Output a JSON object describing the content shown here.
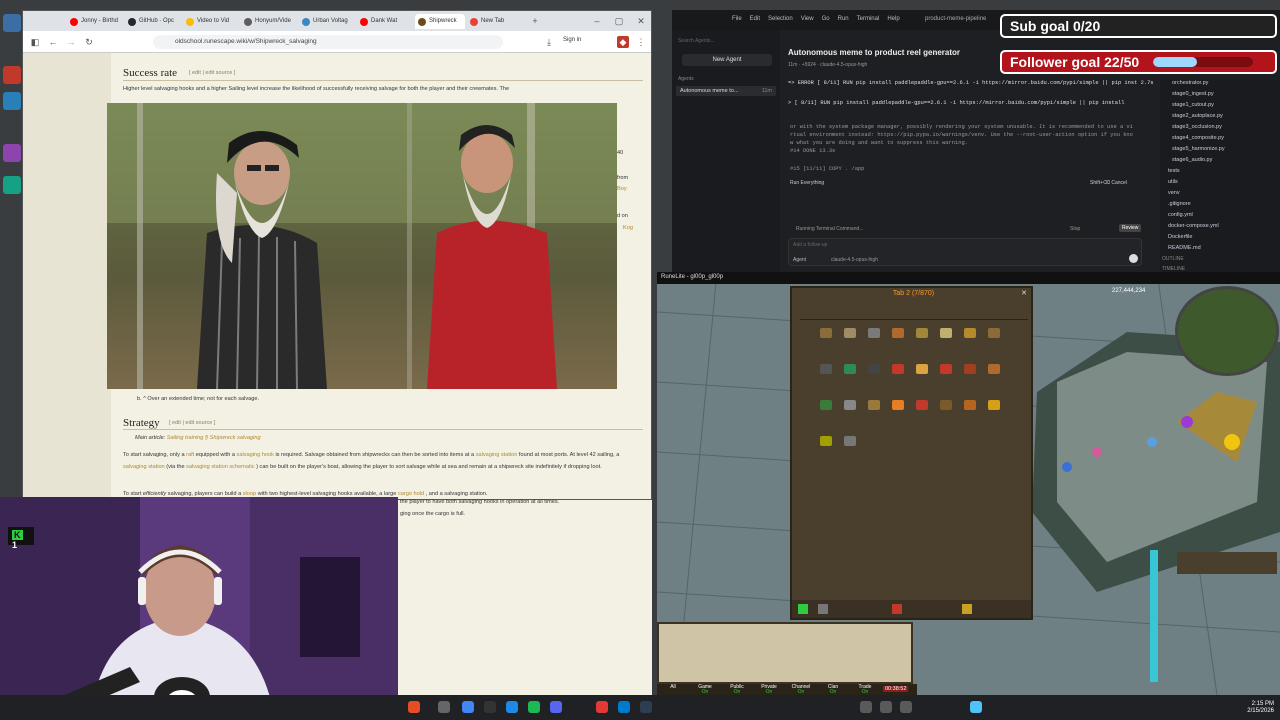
{
  "browser": {
    "tabs": [
      {
        "label": "Jonny - Birthd",
        "color": "#ff0000"
      },
      {
        "label": "GitHub · Opc",
        "color": "#24292e"
      },
      {
        "label": "Video to Vid",
        "color": "#fbbc04"
      },
      {
        "label": "Honyum/Vide",
        "color": "#5e5e5e"
      },
      {
        "label": "Urban Voltag",
        "color": "#3b88c3"
      },
      {
        "label": "Dank Wat",
        "color": "#ff0000"
      },
      {
        "label": "Shipwreck",
        "color": "#6b4c1e"
      },
      {
        "label": "New Tab",
        "color": "#e94235"
      }
    ],
    "url": "oldschool.runescape.wiki/w/Shipwreck_salvaging",
    "sign_in": "Sign in"
  },
  "wiki": {
    "section1_title": "Success rate",
    "section1_edit": "[ edit | edit source ]",
    "section1_text": "Higher level salvaging hooks and a higher Sailing level increase the likelihood of successfully receiving salvage for both the player and their crewmates. The",
    "side_numbers": [
      "40",
      "from",
      "Boy",
      "d on",
      "Kog"
    ],
    "footnote": "b. ^ Over an extended time; not for each salvage.",
    "section2_title": "Strategy",
    "section2_edit": "[ edit | edit source ]",
    "main_article_label": "Main article:",
    "main_article_links": "Sailing training § Shipwreck salvaging",
    "p1a": "To start salvaging, only a",
    "p1_link1": "raft",
    "p1b": "equipped with a",
    "p1_link2": "salvaging hook",
    "p1c": "is required. Salvage obtained from shipwrecks can then be sorted into items at a",
    "p1_link3": "salvaging station",
    "p1d": "found at most ports. At level 42 sailing, a",
    "p1_link4": "salvaging station",
    "p1e": "(via the",
    "p1_link5": "salvaging station schematic",
    "p1f": ") can be built on the player's boat, allowing the player to sort salvage while at sea and remain at a shipwreck site indefinitely if dropping loot.",
    "p2a": "To start",
    "p2_em": "efficiently",
    "p2b": "salvaging, players can build a",
    "p2_link1": "sloop",
    "p2c": "with two highest-level salvaging hooks available, a large",
    "p2_link2": "cargo hold",
    "p2d": ", and a salvaging station.",
    "p3a": "the player to have both salvaging hooks in operation at all times.",
    "p3b": "ging once the cargo is full."
  },
  "editor": {
    "title": "product-meme-pipeline",
    "menu": [
      "File",
      "Edit",
      "Selection",
      "View",
      "Go",
      "Run",
      "Terminal",
      "Help"
    ],
    "search_placeholder": "Search Agents...",
    "new_agent": "New Agent",
    "agents_label": "Agents",
    "agent_item": "Autonomous meme to...",
    "agent_time": "11m",
    "chat_title": "Autonomous meme to product reel generator",
    "chat_meta": "11m · +5924 · claude-4.5-opus-high",
    "log_lines": [
      "=> ERROR [ 8/11] RUN pip install paddlepaddle-gpu==2.6.1 -i https://mirror.baidu.com/pypi/simple || pip inst 2.7s",
      "> [ 8/11] RUN pip install paddlepaddle-gpu==2.6.1 -i https://mirror.baidu.com/pypi/simple || pip install",
      "or with the system package manager, possibly rendering your system unusable. It is recommended to use a vi",
      "rtual environment instead: https://pip.pypa.io/warnings/venv. Use the --root-user-action option if you kno",
      "w what you are doing and want to suppress this warning.",
      "#14 DONE 13.3s",
      "#15 [11/11] COPY . /app"
    ],
    "run_everything": "Run Everything",
    "cancel_hint": "Shift+⌫ Cancel",
    "running": "Running Terminal Command...",
    "stop": "Stop",
    "review": "Review",
    "followup_placeholder": "Add a follow-up",
    "agent_mode": "Agent",
    "model": "claude-4.5-opus-high",
    "files": [
      "orchestrator.py",
      "stage0_ingest.py",
      "stage1_cutout.py",
      "stage2_autoplace.py",
      "stage3_occlusion.py",
      "stage4_composite.py",
      "stage5_harmonize.py",
      "stage6_audio.py",
      "tests",
      "utils",
      "venv",
      ".gitignore",
      "config.yml",
      "docker-compose.yml",
      "Dockerfile",
      "README.md",
      "OUTLINE",
      "TIMELINE"
    ]
  },
  "overlay": {
    "sub_goal": "Sub goal 0/20",
    "follower_goal": "Follower goal 22/50",
    "follower_progress": 0.44,
    "webcam_badge": "1"
  },
  "game": {
    "window_title": "RuneLite - gl00p_gl00p",
    "bank_title": "Tab 2 (7/870)",
    "xp_counter": "227,444,234",
    "chat_tabs": [
      "All",
      "Game",
      "Public",
      "Private",
      "Channel",
      "Clan",
      "Trade"
    ],
    "chat_tab_sub": [
      "",
      "On",
      "On",
      "On",
      "On",
      "On",
      "On"
    ],
    "timer": "00:38:52"
  },
  "taskbar": {
    "time": "2:15 PM",
    "date": "2/15/2026"
  }
}
